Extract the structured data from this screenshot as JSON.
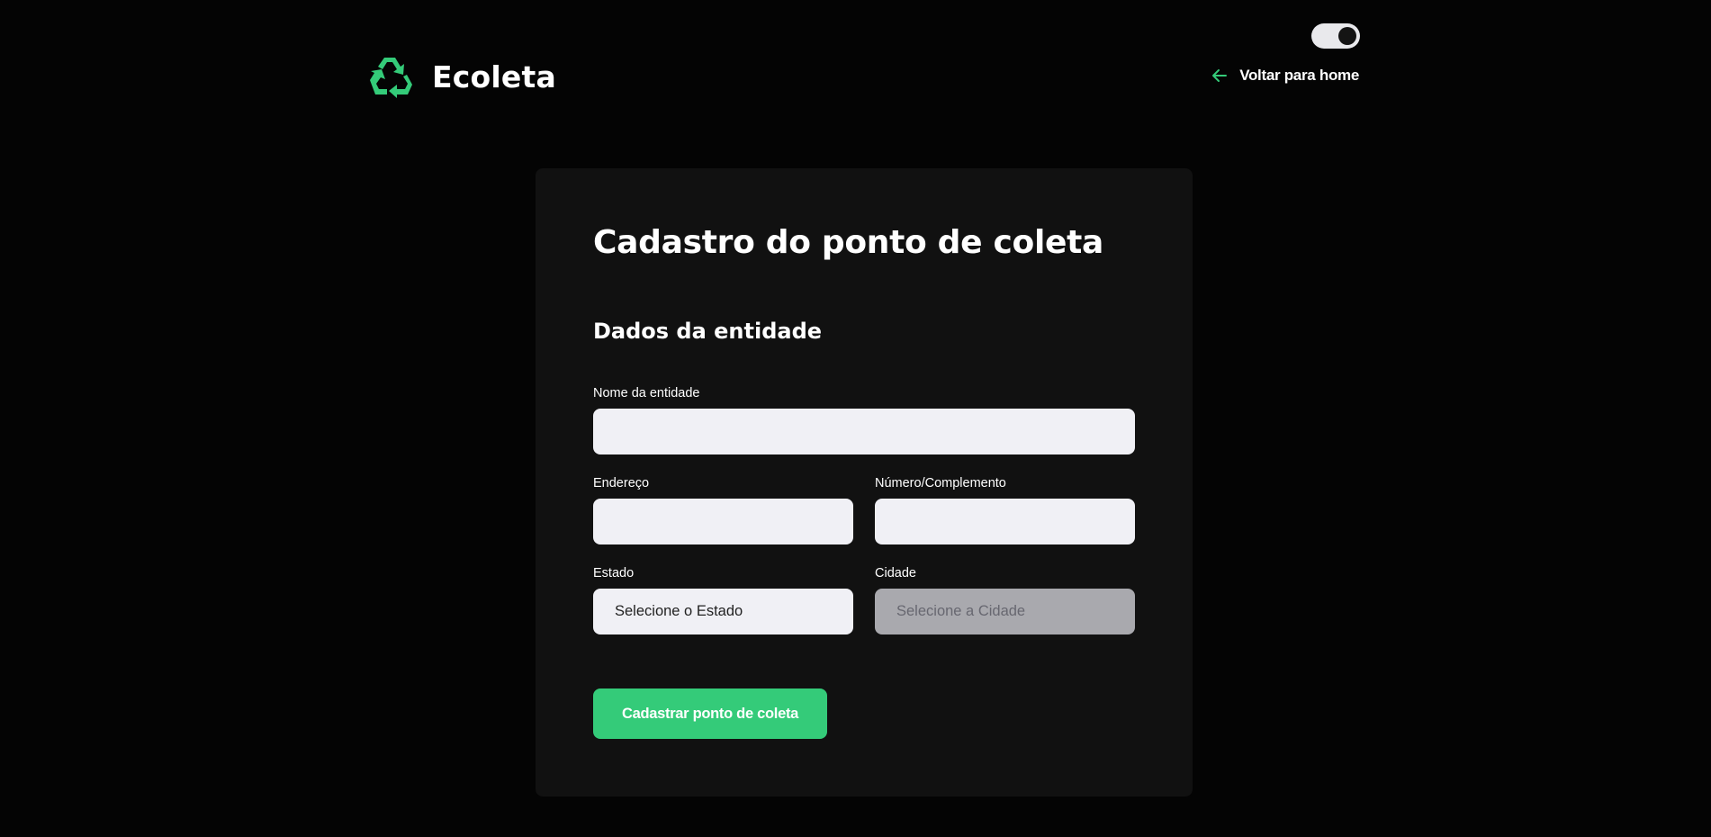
{
  "theme_toggle": {
    "state": "dark"
  },
  "header": {
    "logo_text": "Ecoleta",
    "logo_icon": "recycle-icon",
    "back_link_label": "Voltar para home",
    "back_link_icon": "arrow-left-icon"
  },
  "form": {
    "title": "Cadastro do ponto de coleta",
    "section_title": "Dados da entidade",
    "fields": {
      "name": {
        "label": "Nome da entidade",
        "value": ""
      },
      "address": {
        "label": "Endereço",
        "value": ""
      },
      "number": {
        "label": "Número/Complemento",
        "value": ""
      },
      "state": {
        "label": "Estado",
        "selected": "Selecione o Estado"
      },
      "city": {
        "label": "Cidade",
        "selected": "Selecione a Cidade",
        "disabled": true
      }
    },
    "submit_label": "Cadastrar ponto de coleta"
  },
  "colors": {
    "background": "#040404",
    "card": "#111111",
    "accent": "#34cb79",
    "input_bg": "#f0f0f5",
    "input_disabled_bg": "#a9a9ae"
  }
}
